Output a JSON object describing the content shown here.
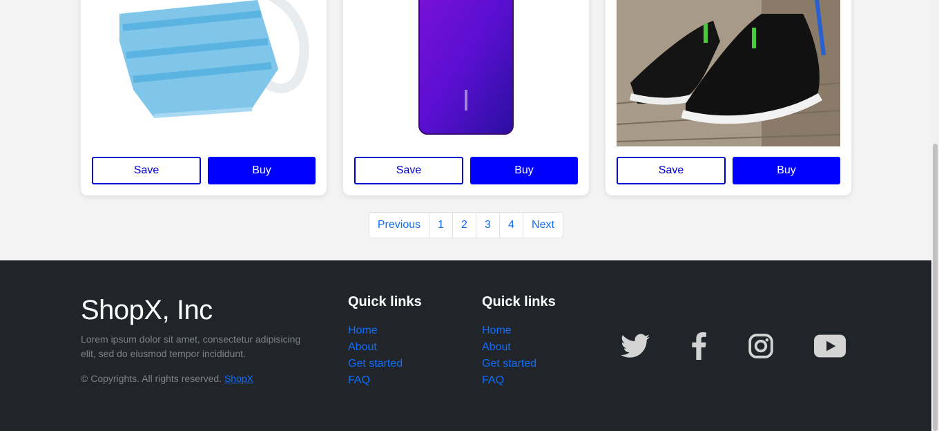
{
  "products": [
    {
      "save_label": "Save",
      "buy_label": "Buy",
      "image": "face-mask-image"
    },
    {
      "save_label": "Save",
      "buy_label": "Buy",
      "image": "smartphone-image"
    },
    {
      "save_label": "Save",
      "buy_label": "Buy",
      "image": "shoes-image"
    }
  ],
  "pagination": {
    "previous": "Previous",
    "pages": [
      "1",
      "2",
      "3",
      "4"
    ],
    "next": "Next"
  },
  "footer": {
    "brand": "ShopX, Inc",
    "description": "Lorem ipsum dolor sit amet, consectetur adipisicing elit, sed do eiusmod tempor incididunt.",
    "copyright": "© Copyrights. All rights reserved.",
    "copyright_link": "ShopX",
    "columns": [
      {
        "title": "Quick links",
        "links": [
          "Home",
          "About",
          "Get started",
          "FAQ"
        ]
      },
      {
        "title": "Quick links",
        "links": [
          "Home",
          "About",
          "Get started",
          "FAQ"
        ]
      }
    ],
    "social": [
      "twitter-icon",
      "facebook-icon",
      "instagram-icon",
      "youtube-icon"
    ]
  },
  "colors": {
    "accent": "#0000ff",
    "link": "#0d6efd",
    "footer_bg": "#212529"
  }
}
